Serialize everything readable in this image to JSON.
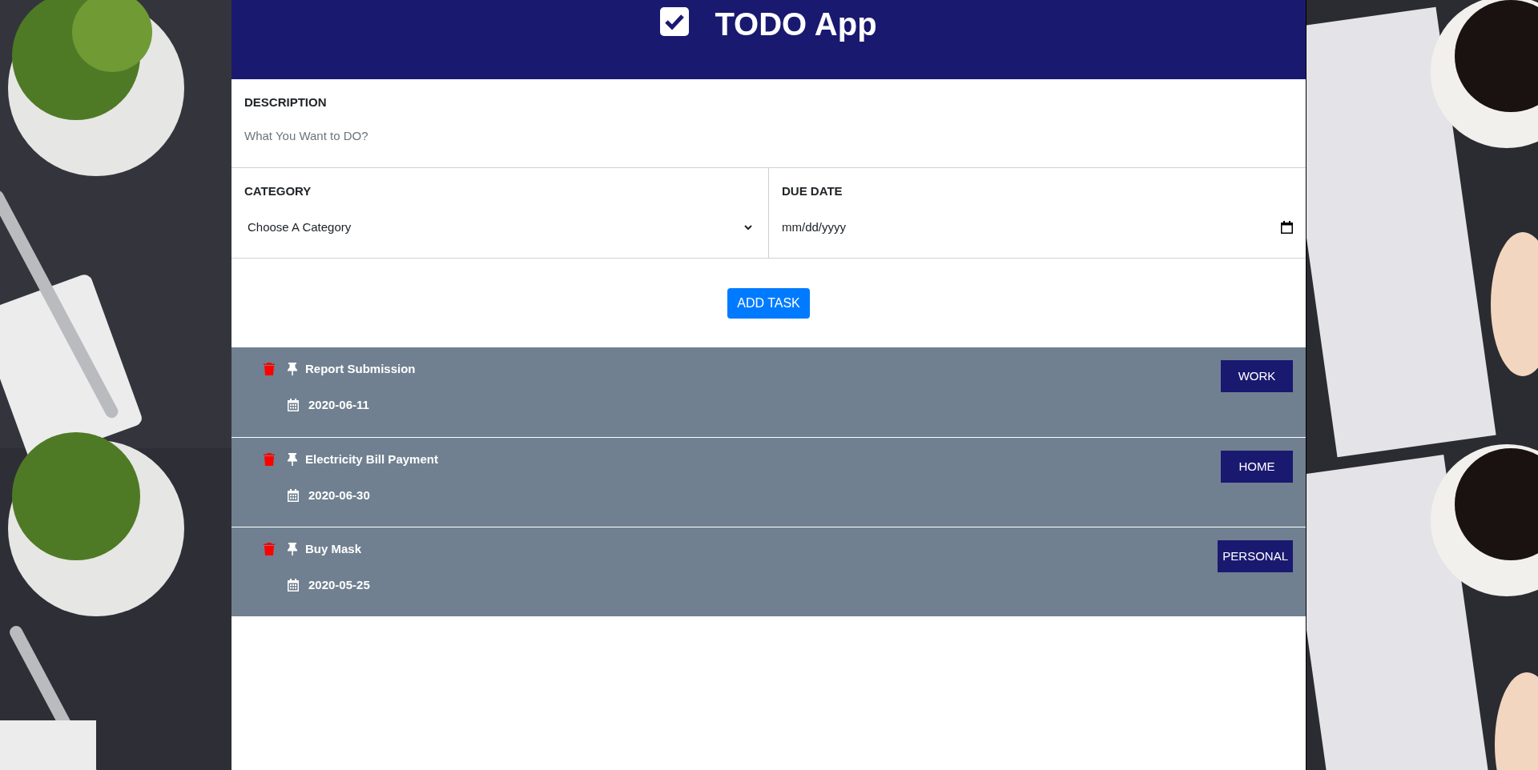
{
  "header": {
    "title": "TODO App"
  },
  "form": {
    "description": {
      "label": "DESCRIPTION",
      "placeholder": "What You Want to DO?"
    },
    "category": {
      "label": "CATEGORY",
      "placeholder": "Choose A Category"
    },
    "due_date": {
      "label": "DUE DATE",
      "placeholder": "mm/dd/yyyy"
    },
    "submit": "ADD TASK"
  },
  "tasks": [
    {
      "title": "Report Submission",
      "date": "2020-06-11",
      "category": "WORK"
    },
    {
      "title": "Electricity Bill Payment",
      "date": "2020-06-30",
      "category": "HOME"
    },
    {
      "title": "Buy Mask",
      "date": "2020-05-25",
      "category": "PERSONAL"
    }
  ]
}
